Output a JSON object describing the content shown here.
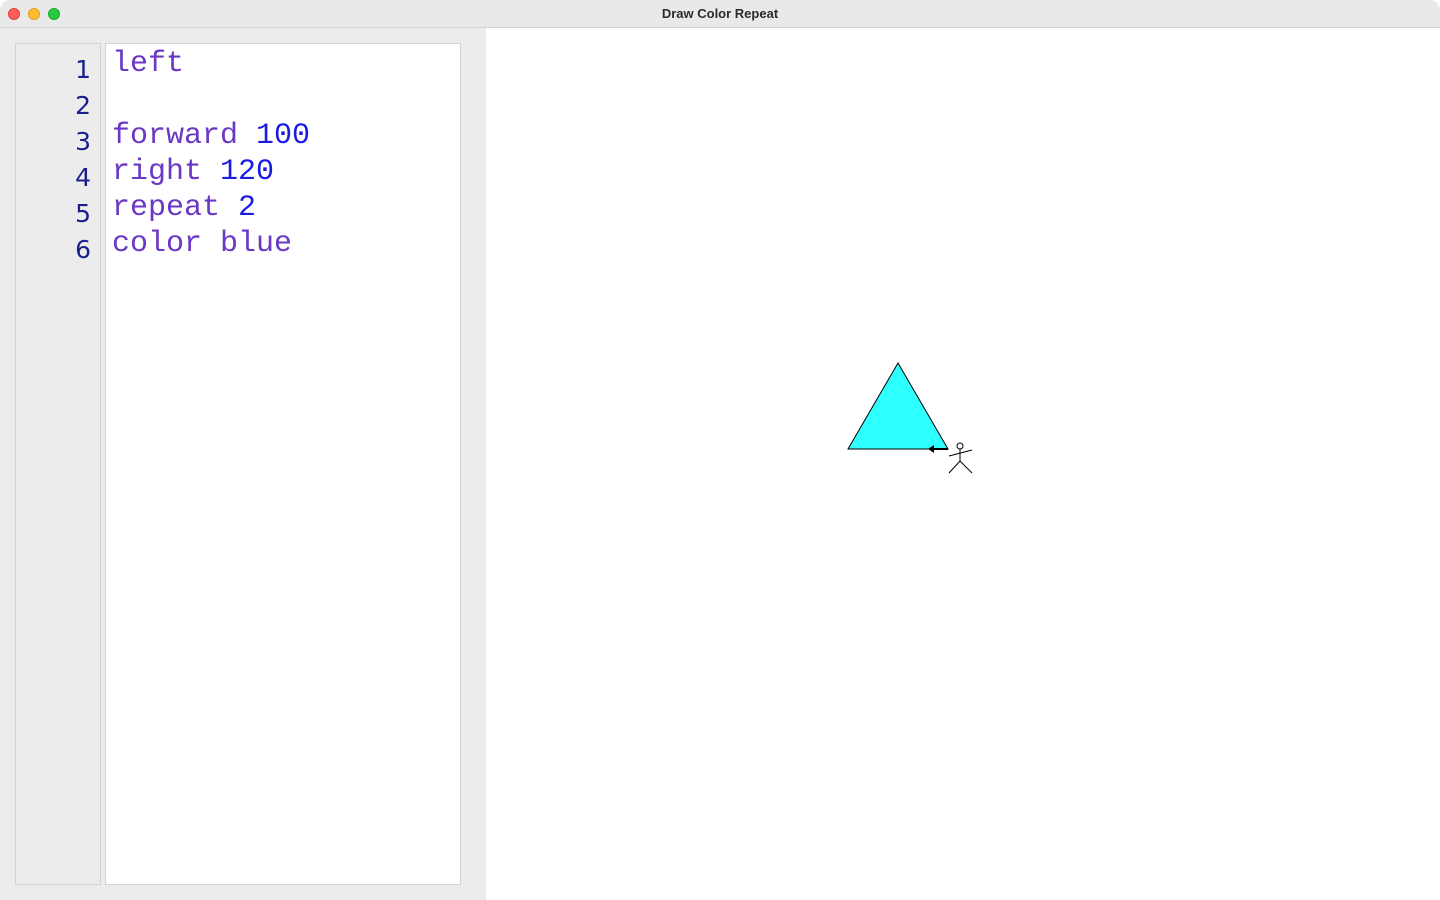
{
  "window": {
    "title": "Draw Color Repeat"
  },
  "editor": {
    "lines": [
      {
        "number": "1",
        "keyword": "left",
        "argument": ""
      },
      {
        "number": "2",
        "keyword": "",
        "argument": ""
      },
      {
        "number": "3",
        "keyword": "forward",
        "argument": "100"
      },
      {
        "number": "4",
        "keyword": "right",
        "argument": "120"
      },
      {
        "number": "5",
        "keyword": "repeat",
        "argument": "2"
      },
      {
        "number": "6",
        "keyword": "color blue",
        "argument": ""
      }
    ]
  },
  "canvas": {
    "shape": "triangle",
    "fill_color": "#2effff",
    "stroke_color": "#000000",
    "turtle_icon": "stick-figure-icon",
    "heading_icon": "arrow-left-icon"
  },
  "colors": {
    "keyword": "#6a38c4",
    "number": "#1a1ae6",
    "line_number": "#1b1f8c"
  }
}
